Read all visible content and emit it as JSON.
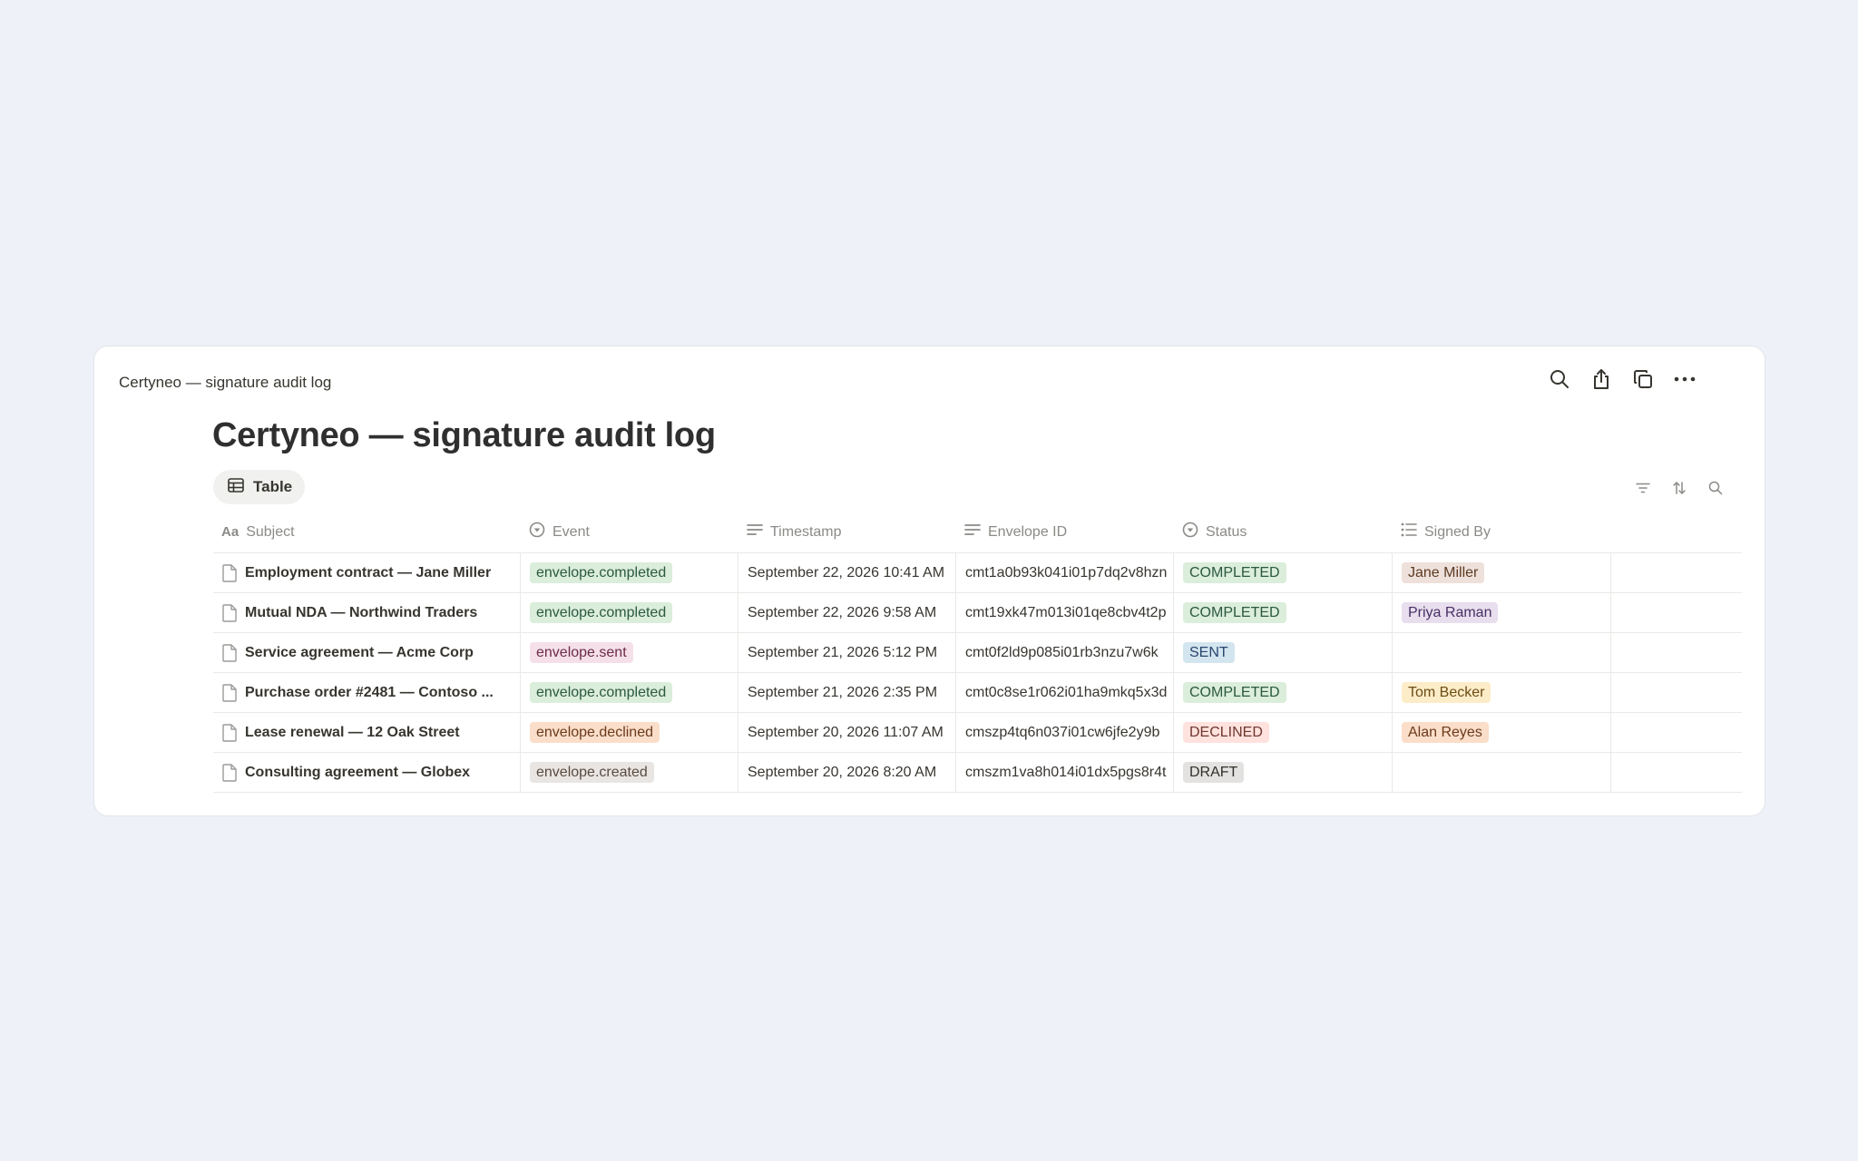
{
  "window": {
    "title": "Certyneo — signature audit log"
  },
  "toolbar": {
    "actions": [
      "search-icon",
      "share-icon",
      "duplicate-icon",
      "more-icon"
    ]
  },
  "page": {
    "title": "Certyneo — signature audit log"
  },
  "view": {
    "tab_label": "Table"
  },
  "table": {
    "columns": [
      {
        "label": "Subject",
        "icon": "text-type-icon"
      },
      {
        "label": "Event",
        "icon": "select-icon"
      },
      {
        "label": "Timestamp",
        "icon": "text-lines-icon"
      },
      {
        "label": "Envelope ID",
        "icon": "text-lines-icon"
      },
      {
        "label": "Status",
        "icon": "select-icon"
      },
      {
        "label": "Signed By",
        "icon": "multi-select-icon"
      }
    ],
    "rows": [
      {
        "subject": "Employment contract — Jane Miller",
        "event": "envelope.completed",
        "timestamp": "September 22, 2026 10:41 AM",
        "envelope_id": "cmt1a0b93k041i01p7dq2v8hzn",
        "status": "COMPLETED",
        "signed_by": "Jane Miller"
      },
      {
        "subject": "Mutual NDA — Northwind Traders",
        "event": "envelope.completed",
        "timestamp": "September 22, 2026 9:58 AM",
        "envelope_id": "cmt19xk47m013i01qe8cbv4t2p",
        "status": "COMPLETED",
        "signed_by": "Priya Raman"
      },
      {
        "subject": "Service agreement — Acme Corp",
        "event": "envelope.sent",
        "timestamp": "September 21, 2026 5:12 PM",
        "envelope_id": "cmt0f2ld9p085i01rb3nzu7w6k",
        "status": "SENT",
        "signed_by": ""
      },
      {
        "subject": "Purchase order #2481 — Contoso ...",
        "event": "envelope.completed",
        "timestamp": "September 21, 2026 2:35 PM",
        "envelope_id": "cmt0c8se1r062i01ha9mkq5x3d",
        "status": "COMPLETED",
        "signed_by": "Tom Becker"
      },
      {
        "subject": "Lease renewal — 12 Oak Street",
        "event": "envelope.declined",
        "timestamp": "September 20, 2026 11:07 AM",
        "envelope_id": "cmszp4tq6n037i01cw6jfe2y9b",
        "status": "DECLINED",
        "signed_by": "Alan Reyes"
      },
      {
        "subject": "Consulting agreement — Globex",
        "event": "envelope.created",
        "timestamp": "September 20, 2026 8:20 AM",
        "envelope_id": "cmszm1va8h014i01dx5pgs8r4t",
        "status": "DRAFT",
        "signed_by": ""
      }
    ]
  },
  "colors": {
    "event": {
      "envelope.completed": {
        "bg": "#dbeddb",
        "fg": "#2b593f"
      },
      "envelope.sent": {
        "bg": "#f5e0e9",
        "fg": "#6b2c47"
      },
      "envelope.declined": {
        "bg": "#fadec9",
        "fg": "#6b3a1c"
      },
      "envelope.created": {
        "bg": "#e9e5e3",
        "fg": "#5a4a3f"
      }
    },
    "status": {
      "COMPLETED": {
        "bg": "#dbeddb",
        "fg": "#2b593f"
      },
      "SENT": {
        "bg": "#d3e5ef",
        "fg": "#28456c"
      },
      "DECLINED": {
        "bg": "#ffe2dd",
        "fg": "#6e3630"
      },
      "DRAFT": {
        "bg": "#e3e2e0",
        "fg": "#32302c"
      }
    },
    "signer": {
      "Jane Miller": {
        "bg": "#eee0da",
        "fg": "#5c3b23"
      },
      "Priya Raman": {
        "bg": "#e8deee",
        "fg": "#492f64"
      },
      "Tom Becker": {
        "bg": "#fdecc8",
        "fg": "#6b4d14"
      },
      "Alan Reyes": {
        "bg": "#fadec9",
        "fg": "#6b3a1c"
      }
    }
  }
}
